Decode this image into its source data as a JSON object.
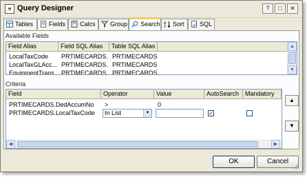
{
  "window": {
    "title": "Query Designer",
    "icon_name": "query-designer-icon"
  },
  "title_buttons": {
    "help": "?",
    "minimize": "_",
    "maximize": "□",
    "close": "✕"
  },
  "tabs": [
    {
      "label": "Tables",
      "icon": "tables-icon",
      "active": false
    },
    {
      "label": "Fields",
      "icon": "fields-icon",
      "active": false
    },
    {
      "label": "Calcs",
      "icon": "calcs-icon",
      "active": false
    },
    {
      "label": "Group",
      "icon": "group-icon",
      "active": false
    },
    {
      "label": "Search",
      "icon": "search-icon",
      "active": true
    },
    {
      "label": "Sort",
      "icon": "sort-icon",
      "active": false
    },
    {
      "label": "SQL",
      "icon": "sql-icon",
      "active": false
    }
  ],
  "available_fields": {
    "header": "Available Fields",
    "columns": [
      "Field Alias",
      "Field SQL Alias",
      "Table SQL Alias"
    ],
    "rows": [
      [
        "LocalTaxCode",
        "PRTIMECARDS...",
        "PRTIMECARDS"
      ],
      [
        "LocalTaxGLAcc...",
        "PRTIMECARDS...",
        "PRTIMECARDS"
      ],
      [
        "EquipmentTrans...",
        "PRTIMECARDS...",
        "PRTIMECARDS"
      ]
    ]
  },
  "criteria": {
    "header": "Criteria",
    "columns": [
      "Field",
      "Operator",
      "Value",
      "AutoSearch",
      "Mandatory"
    ],
    "rows": [
      {
        "field": "PRTIMECARDS.DedAccumNo",
        "operator": ">",
        "value": "0"
      },
      {
        "field": "PRTIMECARDS.LocalTaxCode",
        "operator": "In List",
        "value": "",
        "autosearch": true,
        "mandatory": false
      }
    ],
    "move_up": "▲",
    "move_down": "▼"
  },
  "footer": {
    "ok": "OK",
    "cancel": "Cancel"
  }
}
